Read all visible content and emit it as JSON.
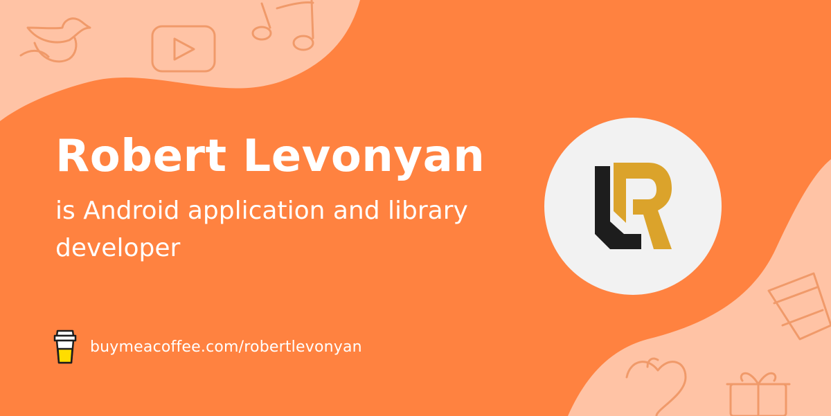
{
  "profile": {
    "name": "Robert Levonyan",
    "tagline": "is Android application and library developer",
    "link_text": "buymeacoffee.com/robertlevonyan"
  },
  "logo": {
    "monogram": "LR"
  },
  "icons": {
    "decor_top_left": [
      "bird-icon",
      "play-button-icon",
      "music-note-icon"
    ],
    "decor_bottom_right": [
      "coffee-cup-icon",
      "heart-pot-icon",
      "gift-box-icon"
    ],
    "footer": "coffee-cup-icon"
  },
  "colors": {
    "background": "#ff8240",
    "accent_light": "#ffc3a5",
    "doodle_stroke": "#f09a6a",
    "text": "#ffffff",
    "avatar_bg": "#f2f2f2",
    "logo_dark": "#1d1d1d",
    "logo_gold": "#dba32b"
  }
}
